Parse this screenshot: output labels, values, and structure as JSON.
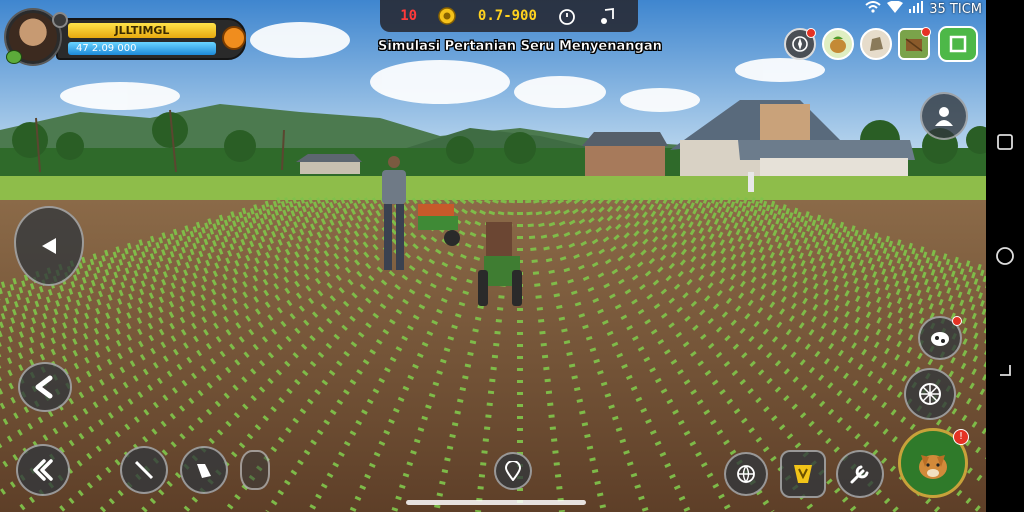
{
  "status": {
    "time": "35 TICM"
  },
  "player": {
    "name": "JLLTIMGL",
    "xp": "47  2.09 000"
  },
  "topbar": {
    "counter_left": "10",
    "coins": "0.7-900"
  },
  "game": {
    "title": "Simulasi Pertanian Seru Menyenangan"
  },
  "top_icons": [
    {
      "name": "compass",
      "badge": ""
    },
    {
      "name": "seed-bag",
      "badge": ""
    },
    {
      "name": "fertilizer-sack",
      "badge": ""
    },
    {
      "name": "crate",
      "badge": ""
    },
    {
      "name": "menu",
      "badge": ""
    }
  ],
  "colors": {
    "accent": "#ffd21e",
    "xp": "#1d8ad8",
    "badge": "#e53224",
    "menu": "#4db848"
  }
}
